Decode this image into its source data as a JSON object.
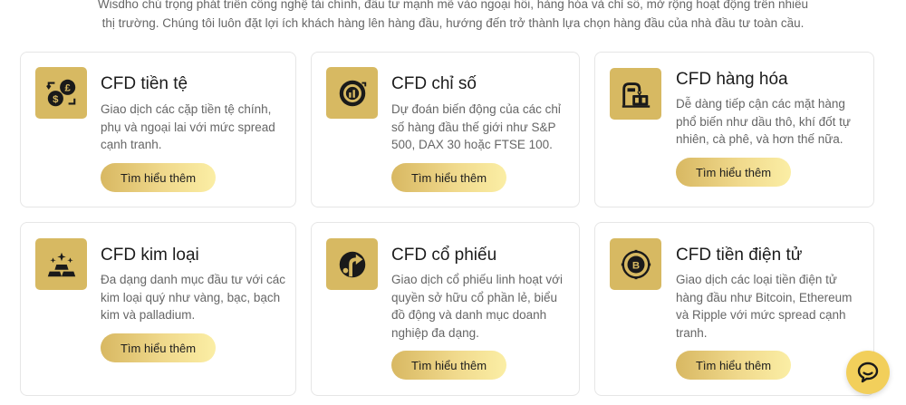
{
  "intro": {
    "line1": "Wisdho chú trọng phát triển công nghệ tài chính, đầu tư mạnh mẽ vào ngoại hối, hàng hóa và chỉ số, mở rộng hoạt động trên nhiều",
    "line2": "thị trường. Chúng tôi luôn đặt lợi ích khách hàng lên hàng đầu, hướng đến trở thành lựa chọn hàng đầu của nhà đầu tư toàn cầu."
  },
  "cards": [
    {
      "icon": "currency-exchange-icon",
      "title": "CFD tiền tệ",
      "desc": [
        "Giao dịch các cặp tiền tệ chính,",
        "phụ và ngoại lai với mức spread",
        "cạnh tranh."
      ],
      "button": "Tìm hiểu thêm"
    },
    {
      "icon": "index-gauge-icon",
      "title": "CFD chỉ số",
      "desc": [
        "Dự đoán biến động của các chỉ",
        "số hàng đầu thế giới như S&P",
        "500, DAX 30 hoặc FTSE 100."
      ],
      "button": "Tìm hiểu thêm"
    },
    {
      "icon": "commodity-icon",
      "title": "CFD hàng hóa",
      "desc": [
        "Dễ dàng tiếp cận các mặt hàng",
        "phổ biến như dầu thô, khí đốt tự",
        "nhiên, cà phê, và hơn thế nữa."
      ],
      "button": "Tìm hiểu thêm"
    },
    {
      "icon": "gold-bars-icon",
      "title": "CFD kim loại",
      "desc": [
        "Đa dạng danh mục đầu tư với các",
        "kim loại quý như vàng, bạc, bạch",
        "kim và palladium."
      ],
      "button": "Tìm hiểu thêm"
    },
    {
      "icon": "stock-arrow-icon",
      "title": "CFD cổ phiếu",
      "desc": [
        "Giao dịch cổ phiếu linh hoạt với",
        "quyền sở hữu cổ phần lẻ, biểu",
        "đồ động và danh mục doanh",
        "nghiệp đa dạng."
      ],
      "button": "Tìm hiểu thêm"
    },
    {
      "icon": "crypto-coin-icon",
      "title": "CFD tiền điện tử",
      "desc": [
        "Giao dịch các loại tiền điện tử",
        "hàng đầu như Bitcoin, Ethereum",
        "và Ripple với mức spread cạnh",
        "tranh."
      ],
      "button": "Tìm hiểu thêm"
    }
  ],
  "colors": {
    "icon_bg": "#d7b962",
    "button_start": "#d8b862",
    "button_end": "#fbeea5",
    "chat": "#f2cf5b"
  },
  "chat": {
    "icon": "chat-bubble-icon"
  }
}
